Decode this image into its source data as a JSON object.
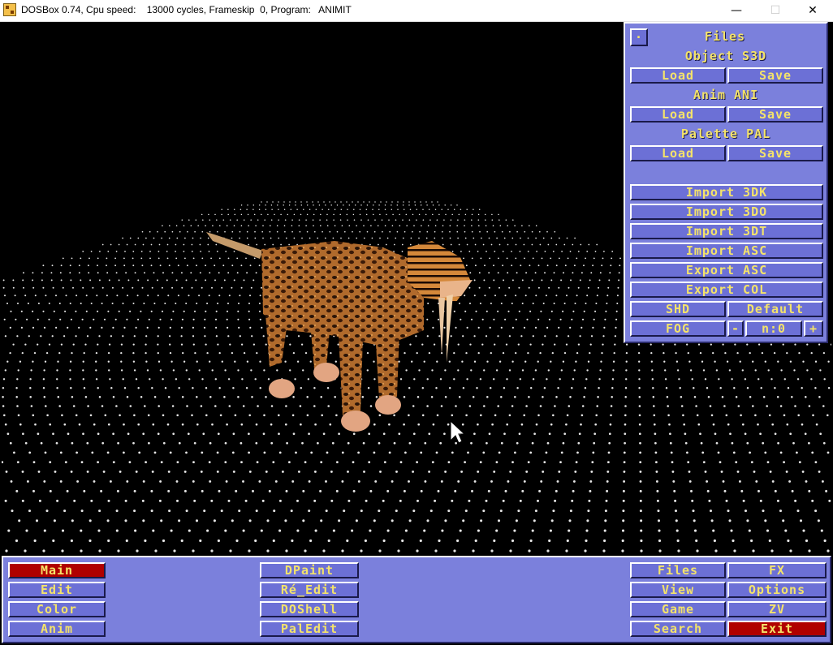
{
  "window": {
    "title": "DOSBox 0.74, Cpu speed:    13000 cycles, Frameskip  0, Program:   ANIMIT",
    "minimize": "—",
    "maximize": "☐",
    "close": "✕"
  },
  "colors": {
    "panel": "#7b80dc",
    "button": "#6c70d6",
    "button_text": "#f4e36a",
    "active_button": "#b00000",
    "viewport": "#000000"
  },
  "files_panel": {
    "close_glyph": "·",
    "heading": "Files",
    "object_label": "Object S3D",
    "object_load": "Load",
    "object_save": "Save",
    "anim_label": "Anim ANI",
    "anim_load": "Load",
    "anim_save": "Save",
    "palette_label": "Palette PAL",
    "palette_load": "Load",
    "palette_save": "Save",
    "import_3dk": "Import 3DK",
    "import_3do": "Import 3DO",
    "import_3dt": "Import 3DT",
    "import_asc": "Import ASC",
    "export_asc": "Export ASC",
    "export_col": "Export COL",
    "shd": "SHD",
    "default": "Default",
    "fog": "FOG",
    "fog_minus": "-",
    "fog_value": "n:0",
    "fog_plus": "+"
  },
  "menubar": {
    "main": "Main",
    "edit": "Edit",
    "color": "Color",
    "anim": "Anim",
    "dpaint": "DPaint",
    "re_edit": "Ré_Edit",
    "doshell": "DOShell",
    "paledit": "PalEdit",
    "files": "Files",
    "fx": "FX",
    "view": "View",
    "options": "Options",
    "game": "Game",
    "zv": "ZV",
    "search": "Search",
    "exit": "Exit"
  },
  "scene": {
    "model": "sabre-tooth-tiger",
    "floor": "dot-grid",
    "cursor": "arrow-pointer-icon"
  }
}
